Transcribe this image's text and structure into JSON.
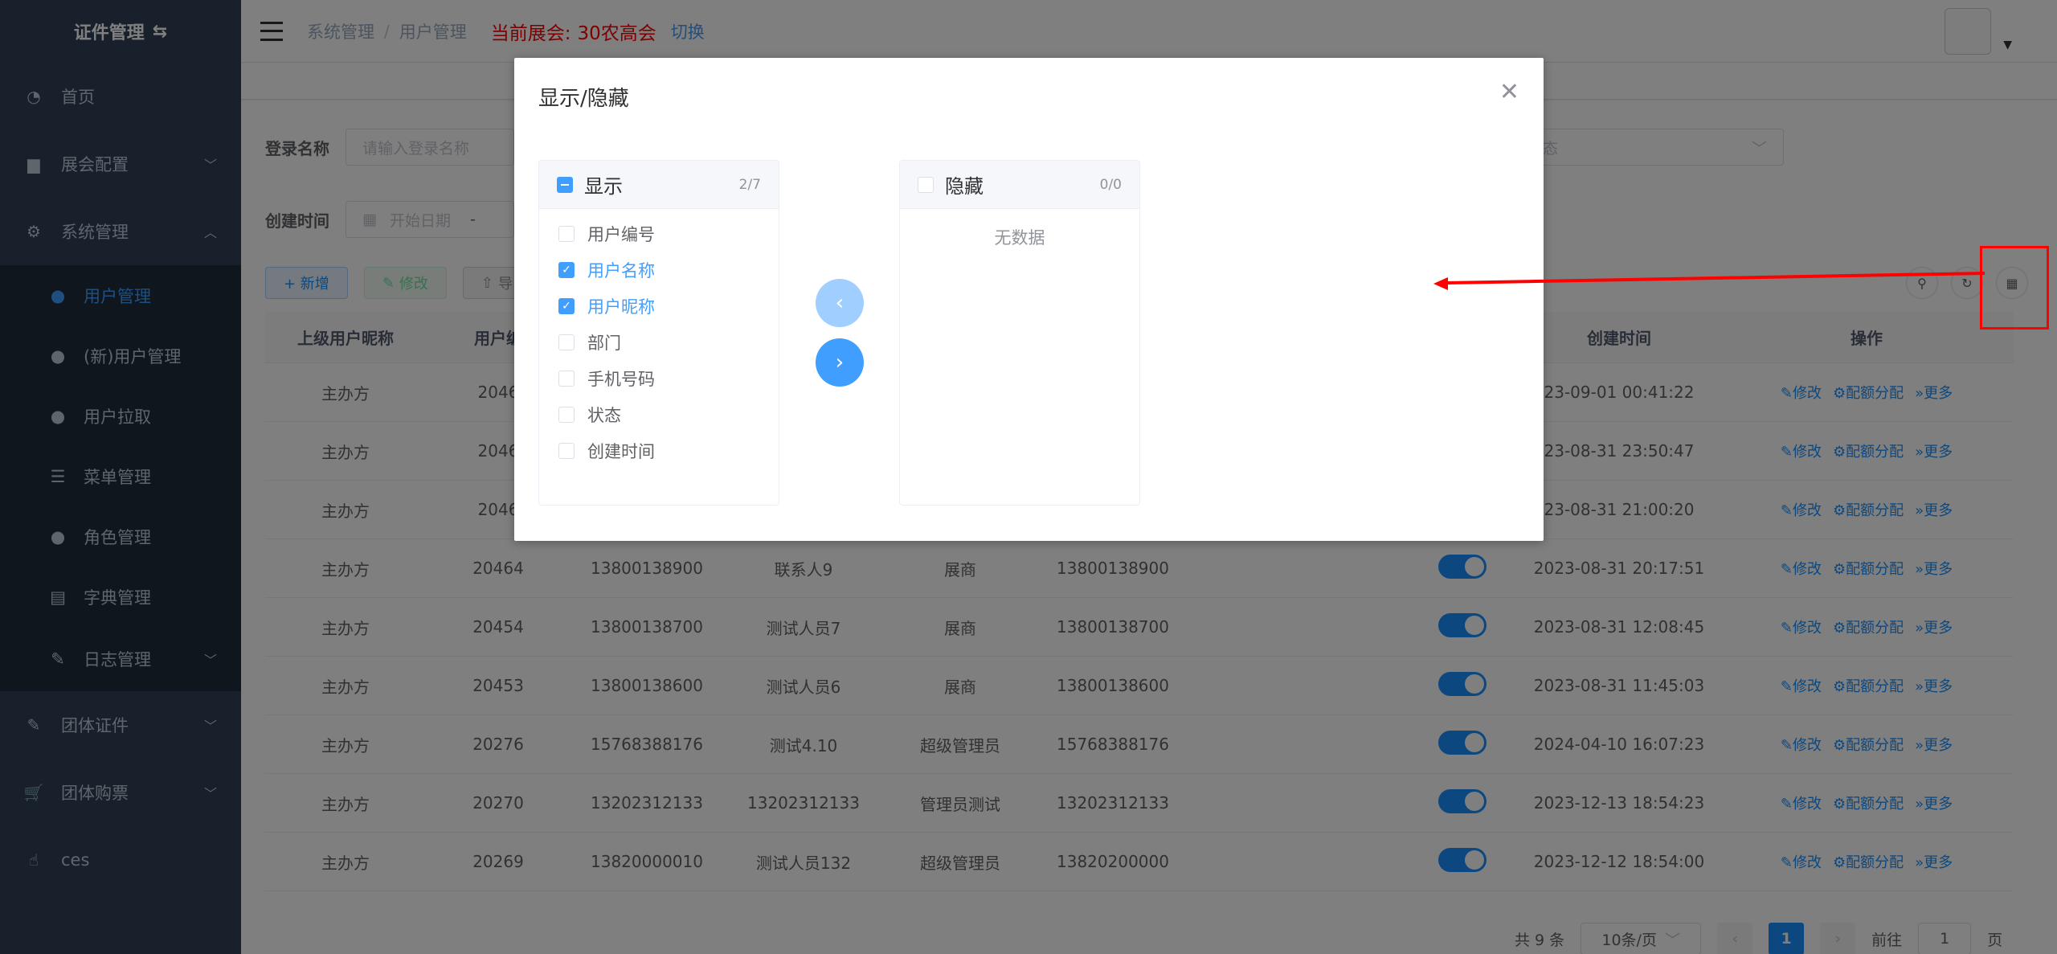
{
  "sidebar": {
    "title": "证件管理",
    "items": [
      {
        "label": "首页"
      },
      {
        "label": "展会配置"
      },
      {
        "label": "系统管理"
      }
    ],
    "sub_items": [
      {
        "label": "用户管理"
      },
      {
        "label": "(新)用户管理"
      },
      {
        "label": "用户拉取"
      },
      {
        "label": "菜单管理"
      },
      {
        "label": "角色管理"
      },
      {
        "label": "字典管理"
      },
      {
        "label": "日志管理"
      }
    ],
    "bottom_items": [
      {
        "label": "团体证件"
      },
      {
        "label": "团体购票"
      },
      {
        "label": "ces"
      }
    ]
  },
  "navbar": {
    "breadcrumb": [
      "系统管理",
      "用户管理"
    ],
    "expo_label": "当前展会:",
    "expo_value": "30农高会",
    "switch_label": "切换"
  },
  "filters": {
    "login_name_label": "登录名称",
    "login_name_placeholder": "请输入登录名称",
    "status_placeholder": "状态",
    "create_time_label": "创建时间",
    "start_date_placeholder": "开始日期",
    "range_sep": "-"
  },
  "toolbar": {
    "add": "+ 新增",
    "edit": "修改",
    "import": "导"
  },
  "table": {
    "headers": [
      "上级用户昵称",
      "用户编",
      "",
      "",
      "",
      "",
      "",
      "创建时间",
      "操作"
    ],
    "ops": [
      "修改",
      "配额分配",
      "更多"
    ],
    "rows": [
      {
        "parent": "主办方",
        "id": "2046",
        "c3": "",
        "c4": "",
        "c5": "",
        "c6": "",
        "time": "23-09-01 00:41:22",
        "toggle": false
      },
      {
        "parent": "主办方",
        "id": "2046",
        "c3": "",
        "c4": "",
        "c5": "",
        "c6": "",
        "time": "23-08-31 23:50:47",
        "toggle": false
      },
      {
        "parent": "主办方",
        "id": "2046",
        "c3": "",
        "c4": "",
        "c5": "",
        "c6": "",
        "time": "23-08-31 21:00:20",
        "toggle": false
      },
      {
        "parent": "主办方",
        "id": "20464",
        "c3": "13800138900",
        "c4": "联系人9",
        "c5": "展商",
        "c6": "13800138900",
        "time": "2023-08-31 20:17:51",
        "toggle": true
      },
      {
        "parent": "主办方",
        "id": "20454",
        "c3": "13800138700",
        "c4": "测试人员7",
        "c5": "展商",
        "c6": "13800138700",
        "time": "2023-08-31 12:08:45",
        "toggle": true
      },
      {
        "parent": "主办方",
        "id": "20453",
        "c3": "13800138600",
        "c4": "测试人员6",
        "c5": "展商",
        "c6": "13800138600",
        "time": "2023-08-31 11:45:03",
        "toggle": true
      },
      {
        "parent": "主办方",
        "id": "20276",
        "c3": "15768388176",
        "c4": "测试4.10",
        "c5": "超级管理员",
        "c6": "15768388176",
        "time": "2024-04-10 16:07:23",
        "toggle": true
      },
      {
        "parent": "主办方",
        "id": "20270",
        "c3": "13202312133",
        "c4": "13202312133",
        "c5": "管理员测试",
        "c6": "13202312133",
        "time": "2023-12-13 18:54:23",
        "toggle": true
      },
      {
        "parent": "主办方",
        "id": "20269",
        "c3": "13820000010",
        "c4": "测试人员132",
        "c5": "超级管理员",
        "c6": "13820200000",
        "time": "2023-12-12 18:54:00",
        "toggle": true
      }
    ]
  },
  "pager": {
    "total": "共 9 条",
    "page_size": "10条/页",
    "current": "1",
    "goto_label": "前往",
    "goto_value": "1",
    "page_unit": "页"
  },
  "dialog": {
    "title": "显示/隐藏",
    "left_panel": {
      "title": "显示",
      "count": "2/7",
      "items": [
        {
          "label": "用户编号",
          "checked": false
        },
        {
          "label": "用户名称",
          "checked": true
        },
        {
          "label": "用户昵称",
          "checked": true
        },
        {
          "label": "部门",
          "checked": false
        },
        {
          "label": "手机号码",
          "checked": false
        },
        {
          "label": "状态",
          "checked": false
        },
        {
          "label": "创建时间",
          "checked": false
        }
      ]
    },
    "right_panel": {
      "title": "隐藏",
      "count": "0/0",
      "empty_text": "无数据"
    }
  },
  "colors": {
    "primary": "#409eff",
    "sidebar_bg": "#304156",
    "annotation": "#ff0000"
  }
}
